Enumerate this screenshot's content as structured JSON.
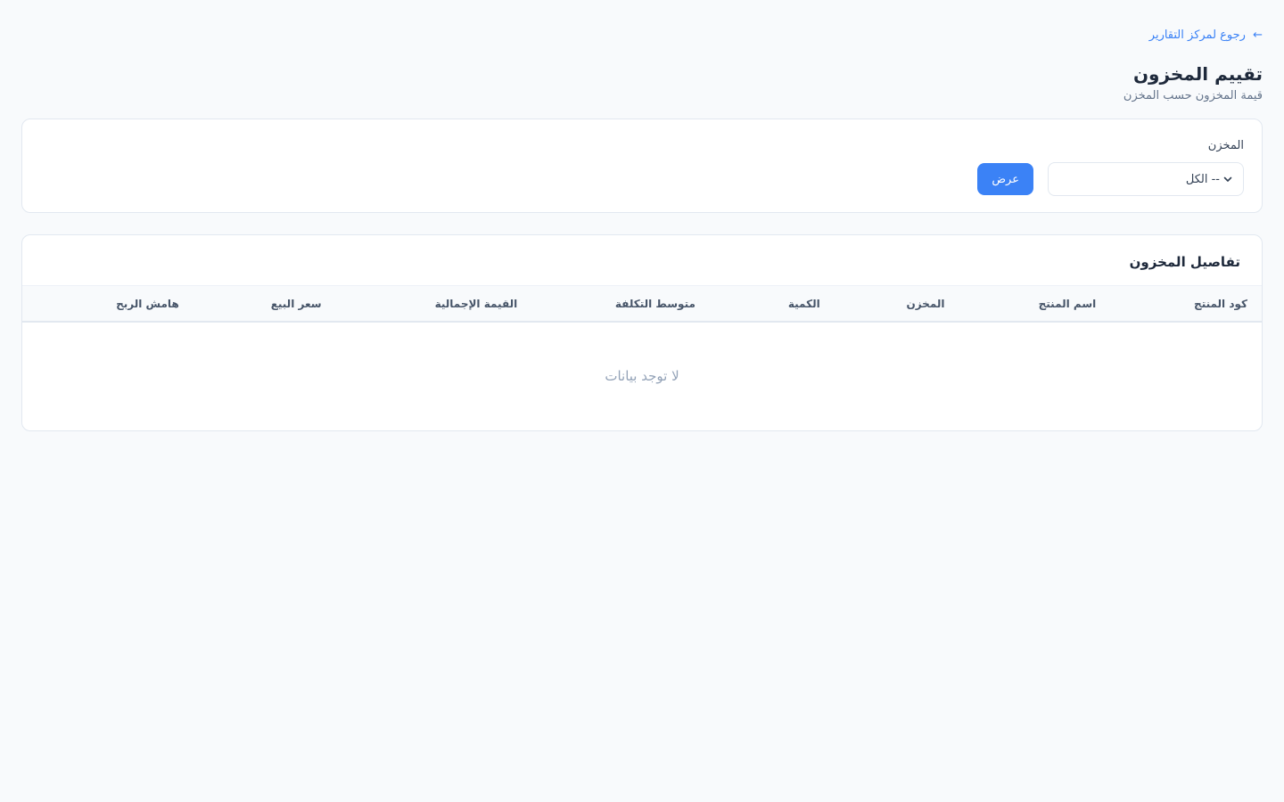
{
  "header": {
    "back_link": "رجوع لمركز التقارير",
    "back_arrow": "←",
    "title": "تقييم المخزون",
    "subtitle": "قيمة المخزون حسب المخزن"
  },
  "filter": {
    "warehouse_label": "المخزن",
    "warehouse_selected": "-- الكل",
    "submit_label": "عرض"
  },
  "details": {
    "title": "تفاصيل المخزون",
    "columns": [
      "كود المنتج",
      "اسم المنتج",
      "المخزن",
      "الكمية",
      "متوسط التكلفة",
      "القيمة الإجمالية",
      "سعر البيع",
      "هامش الربح"
    ],
    "empty_message": "لا توجد بيانات"
  },
  "colors": {
    "accent": "#3b82f6",
    "background": "#f8fafc",
    "card": "#ffffff",
    "border": "#e2e8f0"
  },
  "icons": {
    "back": "arrow-left-icon",
    "select": "chevron-down-icon"
  }
}
